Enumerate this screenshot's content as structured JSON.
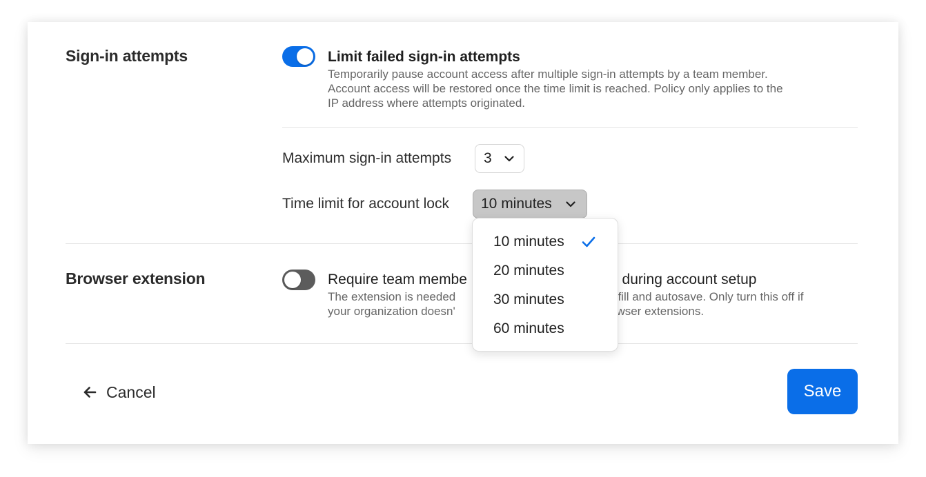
{
  "sign_in": {
    "section_title": "Sign-in attempts",
    "toggle_on": true,
    "option_title": "Limit failed sign-in attempts",
    "description_lines": [
      "Temporarily pause account access after multiple sign-in attempts by a team member.",
      "Account access will be restored once the time limit is reached. Policy only applies to the",
      "IP address where attempts originated."
    ],
    "max_attempts_label": "Maximum sign-in attempts",
    "max_attempts_value": "3",
    "time_limit_label": "Time limit for account lock",
    "time_limit_value": "10 minutes"
  },
  "time_limit_dropdown": {
    "open": true,
    "selected": "10 minutes",
    "options": [
      "10 minutes",
      "20 minutes",
      "30 minutes",
      "60 minutes"
    ]
  },
  "browser_extension": {
    "section_title": "Browser extension",
    "toggle_on": false,
    "option_title_visible_left": "Require team membe",
    "option_title_visible_right": "n during account setup",
    "description_line1_left": "The extension is needed",
    "description_line1_right": "ofill and autosave. Only turn this off if",
    "description_line2_left": "your organization doesn'",
    "description_line2_right": "owser extensions."
  },
  "footer": {
    "cancel_label": "Cancel",
    "save_label": "Save"
  },
  "colors": {
    "accent": "#0a6ee8",
    "toggle_off": "#5c5c5c",
    "open_select_bg": "#c7c7c7"
  },
  "icons": {
    "cancel": "arrow-left-icon",
    "select": "chevron-down-icon",
    "selected_option": "checkmark-icon"
  }
}
